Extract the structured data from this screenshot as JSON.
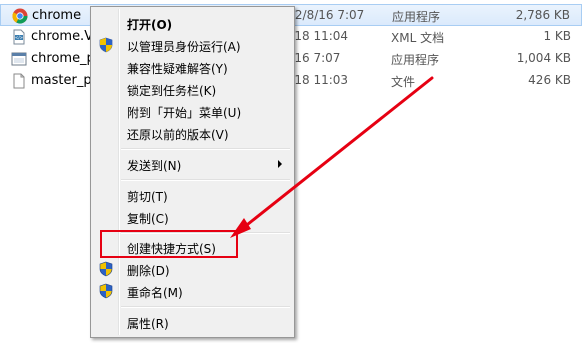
{
  "files": [
    {
      "name": "chrome",
      "date": "2022/8/16 7:07",
      "type": "应用程序",
      "size": "2,786 KB",
      "icon": "chrome-icon",
      "selected": true
    },
    {
      "name": "chrome.Vis",
      "date": "2/8/18 11:04",
      "type": "XML 文档",
      "size": "1 KB",
      "icon": "xml-document-icon",
      "selected": false
    },
    {
      "name": "chrome_pr",
      "date": "2/8/16 7:07",
      "type": "应用程序",
      "size": "1,004 KB",
      "icon": "application-icon",
      "selected": false
    },
    {
      "name": "master_pr",
      "date": "2/8/18 11:03",
      "type": "文件",
      "size": "426 KB",
      "icon": "file-icon",
      "selected": false
    }
  ],
  "context_menu": {
    "items": [
      {
        "label": "打开(O)",
        "bold": true,
        "icon": null
      },
      {
        "label": "以管理员身份运行(A)",
        "icon": "uac-shield-icon"
      },
      {
        "label": "兼容性疑难解答(Y)",
        "icon": null
      },
      {
        "label": "锁定到任务栏(K)",
        "icon": null
      },
      {
        "label": "附到「开始」菜单(U)",
        "icon": null
      },
      {
        "label": "还原以前的版本(V)",
        "icon": null
      },
      {
        "label": "发送到(N)",
        "icon": null,
        "submenu": true
      },
      {
        "label": "剪切(T)",
        "icon": null
      },
      {
        "label": "复制(C)",
        "icon": null
      },
      {
        "label": "创建快捷方式(S)",
        "icon": null,
        "highlighted": true
      },
      {
        "label": "删除(D)",
        "icon": "uac-shield-icon"
      },
      {
        "label": "重命名(M)",
        "icon": "uac-shield-icon"
      },
      {
        "label": "属性(R)",
        "icon": null
      }
    ]
  },
  "colors": {
    "annotation_red": "#e60012",
    "selection_blue": "#a8cdf3"
  }
}
